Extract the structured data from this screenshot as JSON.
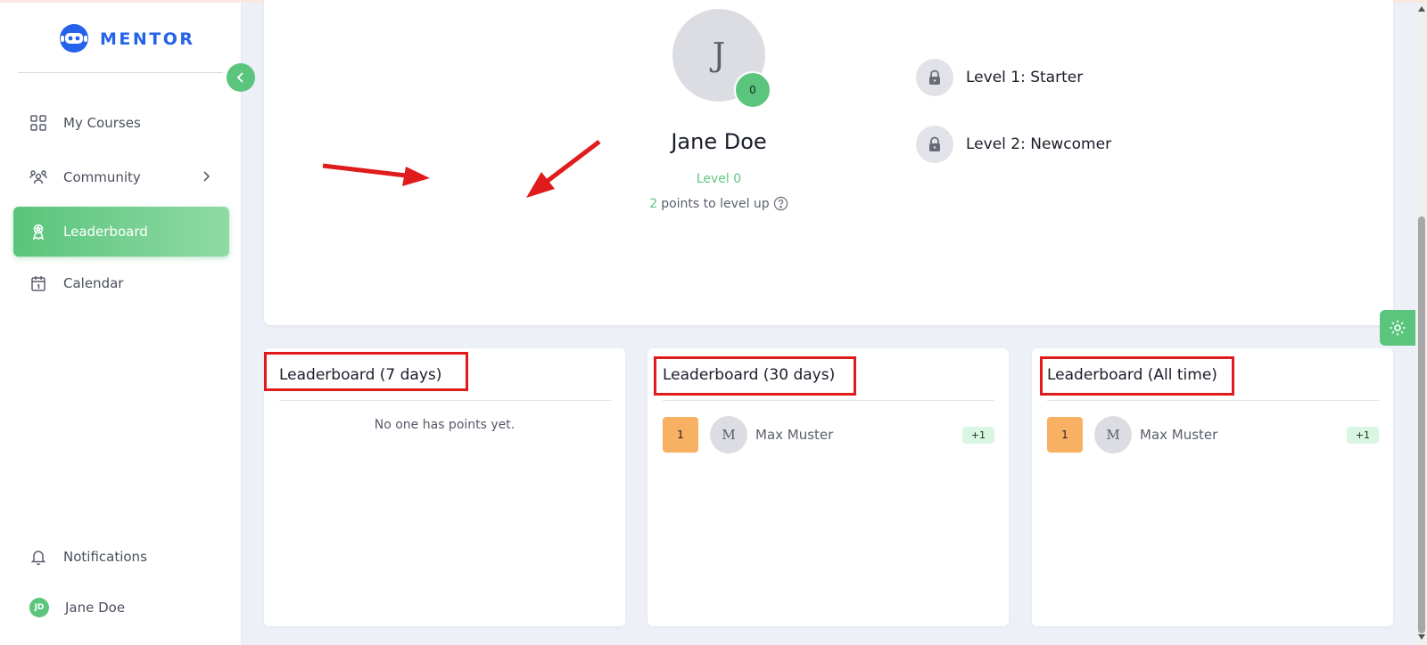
{
  "app": {
    "brand": "MENTOR",
    "accent": "#5bc57d",
    "brand_color": "#2563eb"
  },
  "sidebar": {
    "items": [
      {
        "label": "My Courses",
        "icon": "grid-icon"
      },
      {
        "label": "Community",
        "icon": "users-icon"
      },
      {
        "label": "Leaderboard",
        "icon": "award-icon",
        "active": true
      },
      {
        "label": "Calendar",
        "icon": "calendar-icon"
      }
    ],
    "bottom": {
      "notifications_label": "Notifications",
      "user_initials": "JD",
      "user_name": "Jane Doe"
    }
  },
  "profile": {
    "avatar_letter": "J",
    "badge_points": "0",
    "name": "Jane Doe",
    "level": "Level 0",
    "points_needed": "2",
    "points_suffix": "points to level up"
  },
  "levels": [
    {
      "label": "Level 1: Starter",
      "locked": true
    },
    {
      "label": "Level 2: Newcomer",
      "locked": true
    }
  ],
  "leaderboards": [
    {
      "title": "Leaderboard (7 days)",
      "empty_text": "No one has points yet.",
      "entries": []
    },
    {
      "title": "Leaderboard (30 days)",
      "entries": [
        {
          "rank": "1",
          "avatar": "M",
          "name": "Max Muster",
          "points": "+1"
        }
      ]
    },
    {
      "title": "Leaderboard (All time)",
      "entries": [
        {
          "rank": "1",
          "avatar": "M",
          "name": "Max Muster",
          "points": "+1"
        }
      ]
    }
  ],
  "annotations": {
    "arrow_color": "#e01b1b",
    "box_color": "#e01b1b"
  }
}
